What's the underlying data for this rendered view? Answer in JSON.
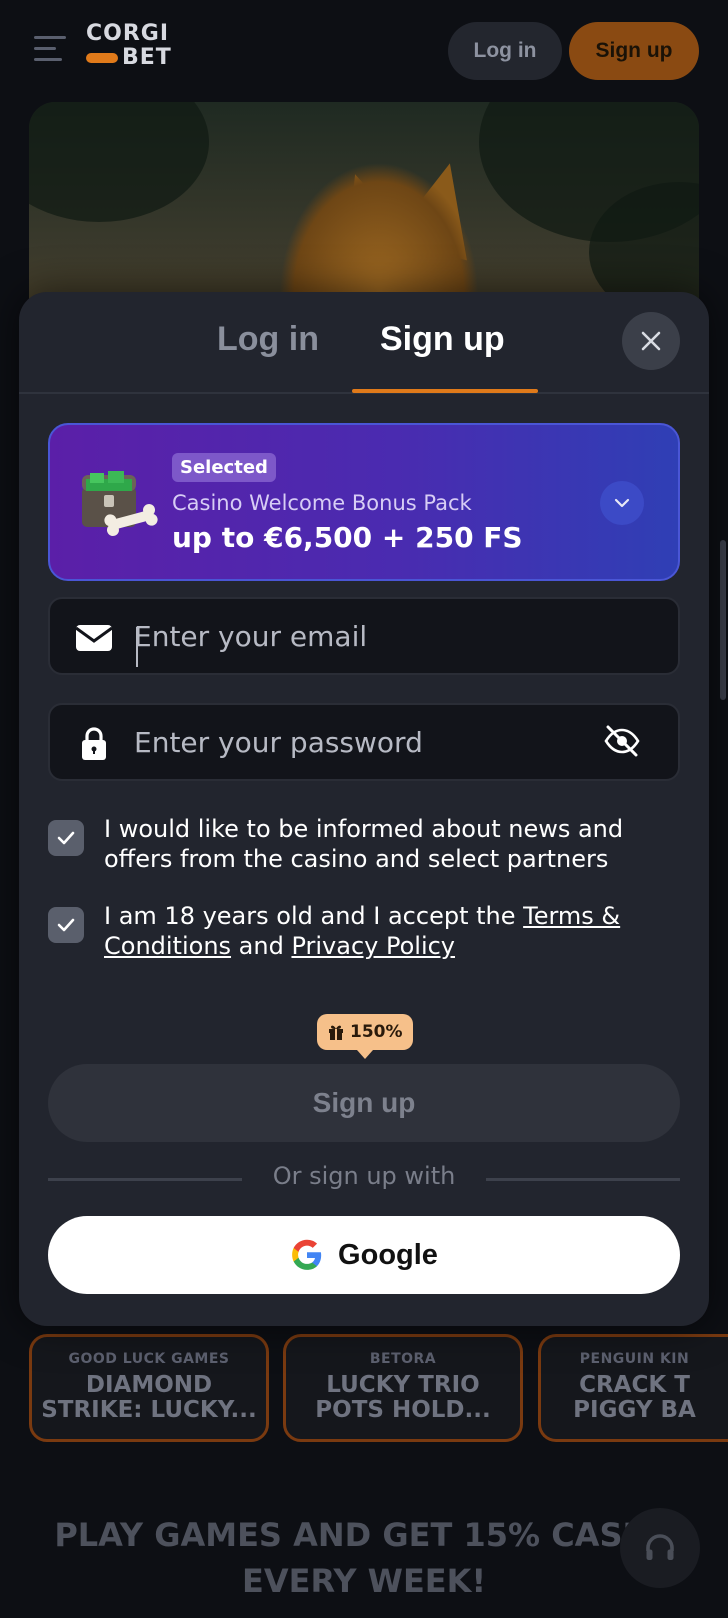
{
  "header": {
    "logo_line1": "CORGI",
    "logo_line2": "BET",
    "login_label": "Log in",
    "signup_label": "Sign up",
    "accent_color": "#e07a1a"
  },
  "modal": {
    "tabs": [
      {
        "label": "Log in",
        "active": false
      },
      {
        "label": "Sign up",
        "active": true
      }
    ],
    "bonus": {
      "badge": "Selected",
      "title": "Casino Welcome Bonus Pack",
      "amount": "up to €6,500 + 250 FS"
    },
    "email": {
      "placeholder": "Enter your email",
      "value": ""
    },
    "password": {
      "placeholder": "Enter your password",
      "value": ""
    },
    "checkboxes": [
      {
        "checked": true,
        "text": "I would like to be informed about news and offers from the casino and select partners"
      },
      {
        "checked": true,
        "text_before": "I am 18 years old and I accept the ",
        "link1": "Terms & Conditions",
        "text_mid": " and ",
        "link2": "Privacy Policy"
      }
    ],
    "bonus_tag": "150%",
    "submit_label": "Sign up",
    "divider_text": "Or sign up with",
    "google_label": "Google"
  },
  "games": [
    {
      "provider": "GOOD LUCK GAMES",
      "name": "DIAMOND\nSTRIKE: LUCKY..."
    },
    {
      "provider": "BETORA",
      "name": "LUCKY TRIO\nPOTS HOLD..."
    },
    {
      "provider": "PENGUIN KIN",
      "name": "CRACK T\nPIGGY BA"
    }
  ],
  "promo": {
    "line1": "PLAY GAMES AND GET 15% CASHB",
    "line2": "EVERY WEEK!"
  }
}
